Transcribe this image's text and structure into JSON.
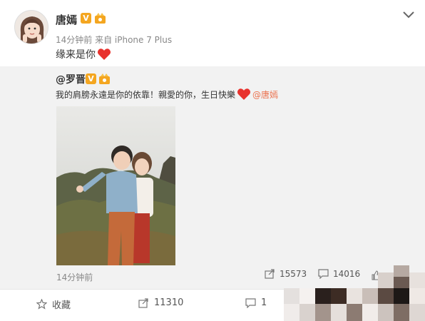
{
  "post": {
    "author": "唐嫣",
    "verified_badge": "V",
    "meta": "14分钟前 来自 iPhone 7 Plus",
    "text": "缘来是你"
  },
  "repost": {
    "author": "@罗晋",
    "verified_badge": "V",
    "text": "我的肩膀永遠是你的依靠！親愛的你，生日快樂",
    "mention": "@唐嫣",
    "time": "14分钟前",
    "share_count": "15573",
    "comment_count": "14016"
  },
  "actions": {
    "favorite_label": "收藏",
    "share_count": "11310",
    "comment_count": "1"
  },
  "colors": {
    "accent": "#eb7350",
    "badge": "#f4a620",
    "heart": "#e8322d"
  },
  "icons": [
    "more-chevron-icon",
    "verified-icon",
    "vip-icon",
    "heart-icon",
    "share-icon",
    "comment-icon",
    "like-icon",
    "star-icon"
  ]
}
